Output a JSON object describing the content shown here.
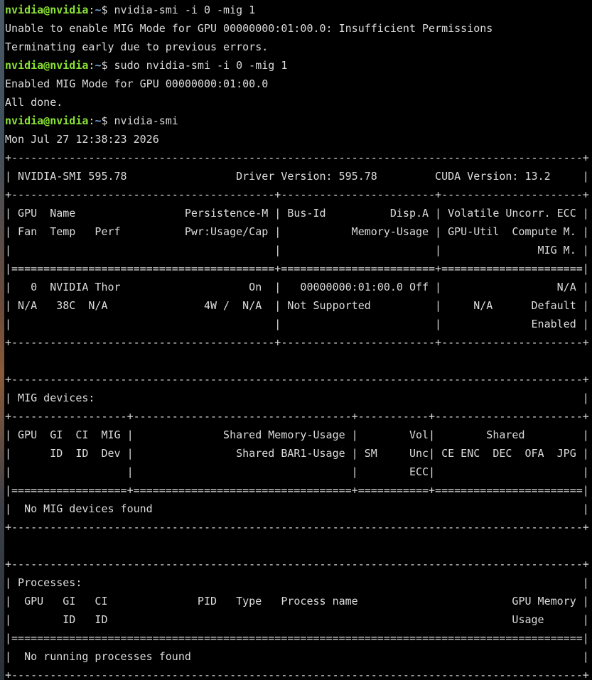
{
  "prompt": {
    "user": "nvidia@nvidia",
    "path": "~",
    "symbol": "$ "
  },
  "colors": {
    "background": "#000000",
    "text": "#dcdcdc",
    "prompt_user": "#8ae234",
    "prompt_path": "#729fcf"
  },
  "lines": [
    {
      "type": "prompt",
      "text": "nvidia-smi -i 0 -mig 1"
    },
    {
      "type": "output",
      "text": "Unable to enable MIG Mode for GPU 00000000:01:00.0: Insufficient Permissions"
    },
    {
      "type": "output",
      "text": "Terminating early due to previous errors."
    },
    {
      "type": "prompt",
      "text": "sudo nvidia-smi -i 0 -mig 1"
    },
    {
      "type": "output",
      "text": "Enabled MIG Mode for GPU 00000000:01:00.0"
    },
    {
      "type": "output",
      "text": "All done."
    },
    {
      "type": "prompt",
      "text": "nvidia-smi"
    },
    {
      "type": "output",
      "text": "Mon Jul 27 12:38:23 2026"
    },
    {
      "type": "output",
      "text": "+-----------------------------------------------------------------------------------------+"
    },
    {
      "type": "output",
      "text": "| NVIDIA-SMI 595.78                 Driver Version: 595.78         CUDA Version: 13.2     |"
    },
    {
      "type": "output",
      "text": "+-----------------------------------------+------------------------+----------------------+"
    },
    {
      "type": "output",
      "text": "| GPU  Name                 Persistence-M | Bus-Id          Disp.A | Volatile Uncorr. ECC |"
    },
    {
      "type": "output",
      "text": "| Fan  Temp   Perf          Pwr:Usage/Cap |           Memory-Usage | GPU-Util  Compute M. |"
    },
    {
      "type": "output",
      "text": "|                                         |                        |               MIG M. |"
    },
    {
      "type": "output",
      "text": "|=========================================+========================+======================|"
    },
    {
      "type": "output",
      "text": "|   0  NVIDIA Thor                    On  |   00000000:01:00.0 Off |                  N/A |"
    },
    {
      "type": "output",
      "text": "| N/A   38C  N/A               4W /  N/A  | Not Supported          |     N/A      Default |"
    },
    {
      "type": "output",
      "text": "|                                         |                        |              Enabled |"
    },
    {
      "type": "output",
      "text": "+-----------------------------------------+------------------------+----------------------+"
    },
    {
      "type": "output",
      "text": ""
    },
    {
      "type": "output",
      "text": "+-----------------------------------------------------------------------------------------+"
    },
    {
      "type": "output",
      "text": "| MIG devices:                                                                            |"
    },
    {
      "type": "output",
      "text": "+------------------+----------------------------------+-----------+-----------------------+"
    },
    {
      "type": "output",
      "text": "| GPU  GI  CI  MIG |              Shared Memory-Usage |        Vol|        Shared         |"
    },
    {
      "type": "output",
      "text": "|      ID  ID  Dev |                Shared BAR1-Usage | SM     Unc| CE ENC  DEC  OFA  JPG |"
    },
    {
      "type": "output",
      "text": "|                  |                                  |        ECC|                       |"
    },
    {
      "type": "output",
      "text": "|==================+==================================+===========+=======================|"
    },
    {
      "type": "output",
      "text": "|  No MIG devices found                                                                   |"
    },
    {
      "type": "output",
      "text": "+-----------------------------------------------------------------------------------------+"
    },
    {
      "type": "output",
      "text": ""
    },
    {
      "type": "output",
      "text": "+-----------------------------------------------------------------------------------------+"
    },
    {
      "type": "output",
      "text": "| Processes:                                                                              |"
    },
    {
      "type": "output",
      "text": "|  GPU   GI   CI              PID   Type   Process name                        GPU Memory |"
    },
    {
      "type": "output",
      "text": "|        ID   ID                                                               Usage      |"
    },
    {
      "type": "output",
      "text": "|=========================================================================================|"
    },
    {
      "type": "output",
      "text": "|  No running processes found                                                             |"
    },
    {
      "type": "output",
      "text": "+-----------------------------------------------------------------------------------------+"
    }
  ]
}
